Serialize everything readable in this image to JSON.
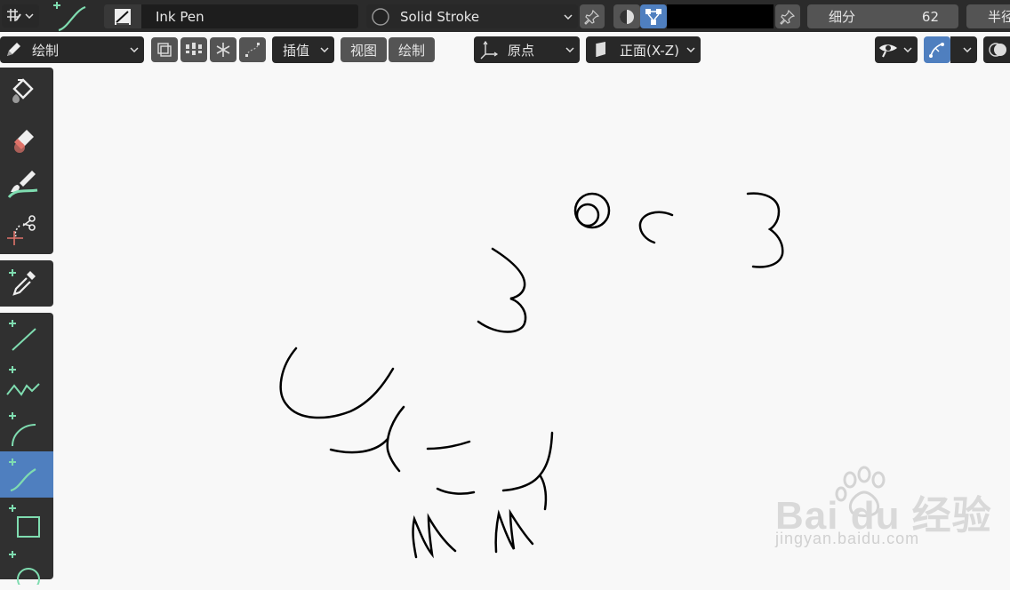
{
  "topbar": {
    "brush_name": "Ink Pen",
    "stroke_material": "Solid Stroke",
    "color_swatch": "#000000",
    "subdivide_label": "细分",
    "subdivide_value": "62",
    "radius_label": "半径"
  },
  "header": {
    "mode_label": "绘制",
    "interpolate_label": "插值",
    "view_label": "视图",
    "draw_label": "绘制",
    "origin_label": "原点",
    "orientation_label": "正面(X-Z)"
  },
  "toolbar": {
    "tools": [
      {
        "name": "fill-tool",
        "icon": "paint-bucket-icon",
        "active": false
      },
      {
        "name": "erase-tool",
        "icon": "eraser-icon",
        "active": false
      },
      {
        "name": "tint-tool",
        "icon": "tint-brush-icon",
        "active": false
      },
      {
        "name": "cutter-tool",
        "icon": "scissors-icon",
        "active": false
      },
      {
        "name": "eyedropper-tool",
        "icon": "eyedropper-icon",
        "active": false
      },
      {
        "name": "line-tool",
        "icon": "line-icon",
        "active": false
      },
      {
        "name": "polyline-tool",
        "icon": "polyline-icon",
        "active": false
      },
      {
        "name": "arc-tool",
        "icon": "arc-icon",
        "active": false
      },
      {
        "name": "curve-tool",
        "icon": "curve-icon",
        "active": true
      },
      {
        "name": "box-tool",
        "icon": "box-icon",
        "active": false
      },
      {
        "name": "circle-tool",
        "icon": "circle-icon",
        "active": false
      }
    ]
  },
  "colors": {
    "active_tool": "#4f7fbf",
    "panel": "#303030",
    "canvas": "#f8f8f8",
    "tool_accent": "#7fdcb0"
  },
  "watermark": {
    "logo": "Bai du 经验",
    "url": "jingyan.baidu.com"
  }
}
